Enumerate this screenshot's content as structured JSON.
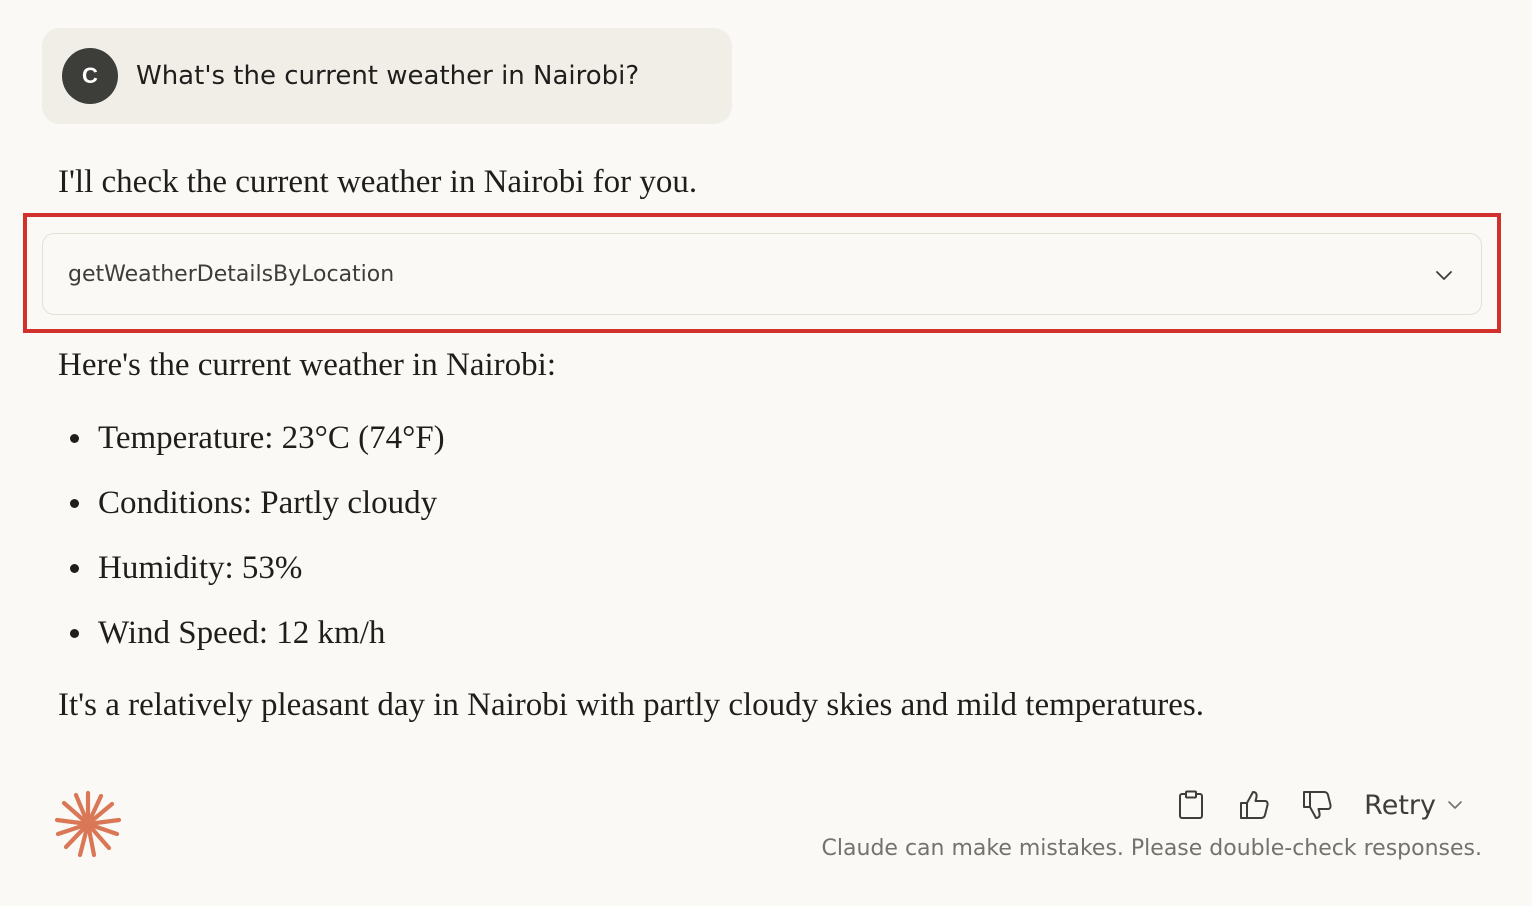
{
  "user_message": {
    "avatar_initial": "C",
    "text": "What's the current weather in Nairobi?"
  },
  "assistant": {
    "intro": "I'll check the current weather in Nairobi for you.",
    "tool_call": {
      "name": "getWeatherDetailsByLocation",
      "expand_icon": "chevron-down-icon"
    },
    "heading": "Here's the current weather in Nairobi:",
    "bullets": [
      "Temperature: 23°C (74°F)",
      "Conditions: Partly cloudy",
      "Humidity: 53%",
      "Wind Speed: 12 km/h"
    ],
    "closing": "It's a relatively pleasant day in Nairobi with partly cloudy skies and mild temperatures."
  },
  "footer": {
    "logo_icon": "claude-spark-icon",
    "actions": {
      "copy_icon": "clipboard-icon",
      "thumbs_up_icon": "thumbs-up-icon",
      "thumbs_down_icon": "thumbs-down-icon",
      "retry_label": "Retry"
    },
    "disclaimer": "Claude can make mistakes. Please double-check responses."
  },
  "colors": {
    "background": "#faf9f5",
    "user_bubble": "#f0eee6",
    "avatar": "#3d3d3a",
    "highlight": "#d0312d",
    "brand_accent": "#d97757"
  }
}
